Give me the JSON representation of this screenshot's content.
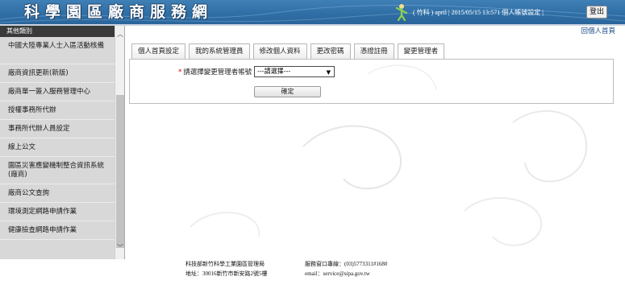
{
  "header": {
    "site_title": "科學園區廠商服務網",
    "user_info": "( 竹科 ) april | 2015/05/15 13:571 個人帳號設定 |",
    "logout_label": "登出"
  },
  "sidebar": {
    "title": "其他類別",
    "items": [
      {
        "label": "中國大陸專業人士入區活動核備"
      },
      {
        "label": "廠商資訊更新(新版)"
      },
      {
        "label": "廠商單一簽入服務管理中心"
      },
      {
        "label": "授權事務所代辦"
      },
      {
        "label": "事務所代辦人員設定"
      },
      {
        "label": "線上公文"
      },
      {
        "label": "園區災害應變機制整合資訊系統 (廠商)"
      },
      {
        "label": "廠商公文查詢"
      },
      {
        "label": "環境測定網路申請作業"
      },
      {
        "label": "健康檢查網路申請作業"
      }
    ]
  },
  "main": {
    "personal_home_link": "回個人首頁",
    "tabs": [
      {
        "label": "個人首頁設定"
      },
      {
        "label": "我的系統管理員"
      },
      {
        "label": "修改個人資料"
      },
      {
        "label": "更改密碼"
      },
      {
        "label": "憑證註冊"
      },
      {
        "label": "變更管理者"
      }
    ],
    "form": {
      "required_mark": "*",
      "field_label": "請選擇變更管理者帳號",
      "select_value": "---請選擇---",
      "confirm_label": "確定"
    }
  },
  "footer": {
    "org": "科技部新竹科學工業園區管理局",
    "address": "地址：30016新竹市新安路2號5樓",
    "hotline": "服務窗口專線：(03)5773311#1680",
    "email": "email：service@sipa.gov.tw"
  },
  "colors": {
    "header_blue": "#2f6fa6",
    "sidebar_bg": "#d8d8d8",
    "sidebar_header_bg": "#3a3a3a",
    "required_red": "#cc0000",
    "link_blue": "#1f4e8c"
  }
}
